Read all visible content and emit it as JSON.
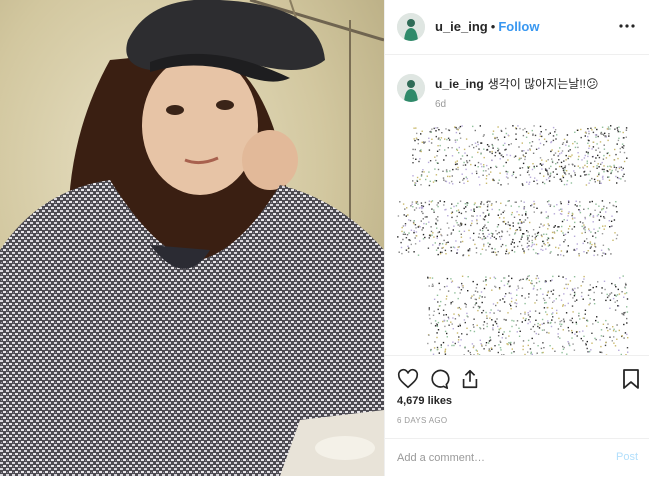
{
  "header": {
    "username": "u_ie_ing",
    "separator": "•",
    "follow_label": "Follow"
  },
  "caption": {
    "username": "u_ie_ing",
    "text": "생각이 많아지는날!!",
    "emoji": "😕",
    "time": "6d"
  },
  "actions": {
    "like_icon": "heart-icon",
    "comment_icon": "comment-bubble-icon",
    "share_icon": "share-icon",
    "save_icon": "bookmark-icon"
  },
  "likes": "4,679 likes",
  "posted_ago": "6 DAYS AGO",
  "comment_box": {
    "placeholder": "Add a comment…",
    "post_label": "Post"
  },
  "colors": {
    "link": "#3897f0",
    "post_disabled": "#b2dffc"
  }
}
